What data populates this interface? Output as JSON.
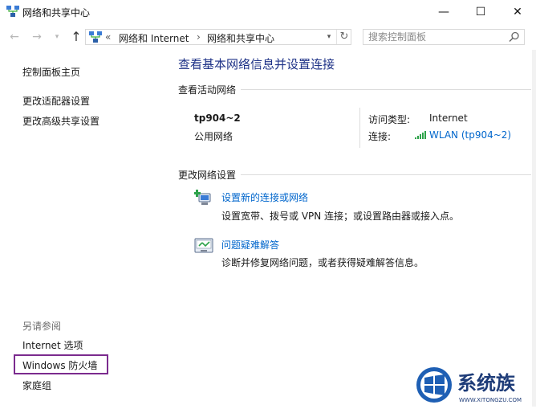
{
  "window": {
    "title": "网络和共享中心",
    "controls": {
      "minimize": "—",
      "maximize": "☐",
      "close": "✕"
    }
  },
  "navbar": {
    "back_icon": "←",
    "forward_icon": "→",
    "recent_icon": "▾",
    "up_icon": "↑",
    "address": {
      "prefix": "«",
      "crumbs": [
        "网络和 Internet",
        "网络和共享中心"
      ],
      "separator": "›",
      "dropdown_icon": "▾",
      "refresh_icon": "↻"
    },
    "search": {
      "placeholder": "搜索控制面板"
    }
  },
  "sidebar": {
    "links": [
      "控制面板主页",
      "更改适配器设置",
      "更改高级共享设置"
    ],
    "see_also_title": "另请参阅",
    "see_also": [
      "Internet 选项",
      "Windows 防火墙",
      "家庭组"
    ]
  },
  "main": {
    "heading": "查看基本网络信息并设置连接",
    "active_networks_title": "查看活动网络",
    "network": {
      "name": "tp904~2",
      "type": "公用网络",
      "access_type_label": "访问类型:",
      "access_type_value": "Internet",
      "connection_label": "连接:",
      "connection_value": "WLAN (tp904~2)"
    },
    "change_settings_title": "更改网络设置",
    "tasks": [
      {
        "link": "设置新的连接或网络",
        "desc": "设置宽带、拨号或 VPN 连接；或设置路由器或接入点。"
      },
      {
        "link": "问题疑难解答",
        "desc": "诊断并修复网络问题，或者获得疑难解答信息。"
      }
    ]
  },
  "watermark": {
    "brand": "系统族",
    "url": "WWW.XITONGZU.COM"
  },
  "colors": {
    "heading": "#1e3287",
    "link": "#0066cc",
    "highlight_box": "#7b2b8e",
    "signal": "#2da24a"
  }
}
